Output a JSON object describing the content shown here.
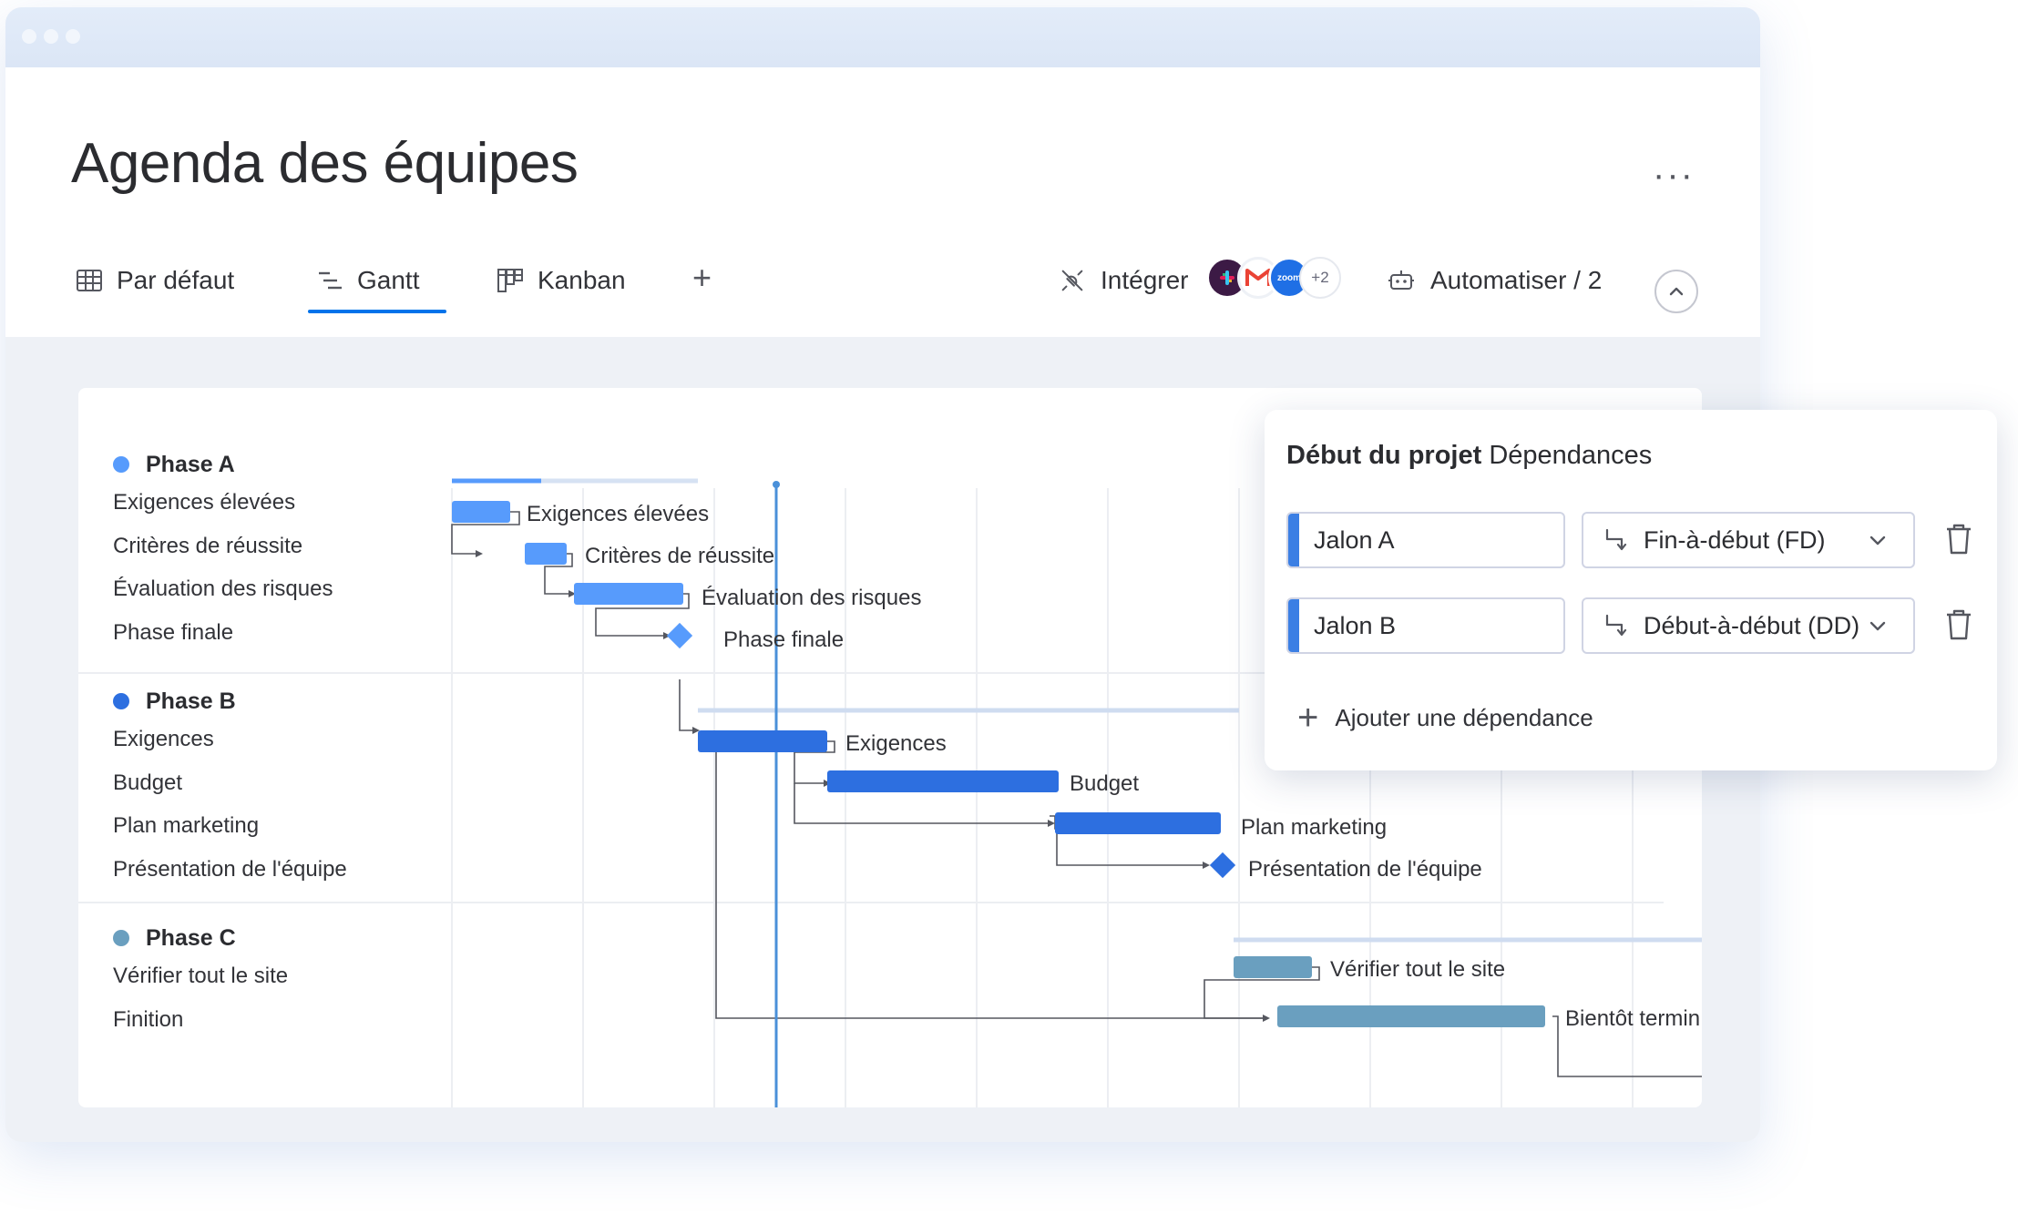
{
  "window": {
    "title": "Agenda des équipes",
    "more_label": "···"
  },
  "tabs": [
    {
      "label": "Par défaut",
      "icon": "table-icon",
      "active": false
    },
    {
      "label": "Gantt",
      "icon": "gantt-icon",
      "active": true
    },
    {
      "label": "Kanban",
      "icon": "kanban-icon",
      "active": false
    }
  ],
  "add_view_label": "+",
  "integrate": {
    "label": "Intégrer",
    "icon": "integrate-icon",
    "apps": [
      "slack",
      "gmail",
      "zoom"
    ],
    "extra_count": "+2"
  },
  "automate": {
    "label": "Automatiser / 2",
    "icon": "robot-icon"
  },
  "colors": {
    "accent": "#0073ea",
    "phase_a": "#579bfc",
    "phase_b": "#2d6fe0",
    "phase_c": "#6a9fbf",
    "today_line": "#4a90d9"
  },
  "groups": [
    {
      "name": "Phase A",
      "color": "#579bfc",
      "items": [
        "Exigences élevées",
        "Critères de réussite",
        "Évaluation des risques",
        "Phase finale"
      ]
    },
    {
      "name": "Phase B",
      "color": "#2d6fe0",
      "items": [
        "Exigences",
        "Budget",
        "Plan marketing",
        "Présentation de l'équipe"
      ]
    },
    {
      "name": "Phase C",
      "color": "#6a9fbf",
      "items": [
        "Vérifier tout le site",
        "Finition"
      ]
    }
  ],
  "bar_labels": {
    "a1": "Exigences élevées",
    "a2": "Critères de réussite",
    "a3": "Évaluation des risques",
    "a4": "Phase finale",
    "b1": "Exigences",
    "b2": "Budget",
    "b3": "Plan marketing",
    "b4": "Présentation de l'équipe",
    "c1": "Vérifier tout le site",
    "c2": "Bientôt termin"
  },
  "panel": {
    "title_bold": "Début du projet",
    "title_rest": " Dépendances",
    "dependencies": [
      {
        "milestone": "Jalon A",
        "type": "Fin-à-début (FD)"
      },
      {
        "milestone": "Jalon B",
        "type": "Début-à-début (DD)"
      }
    ],
    "add_label": "Ajouter une dépendance"
  }
}
